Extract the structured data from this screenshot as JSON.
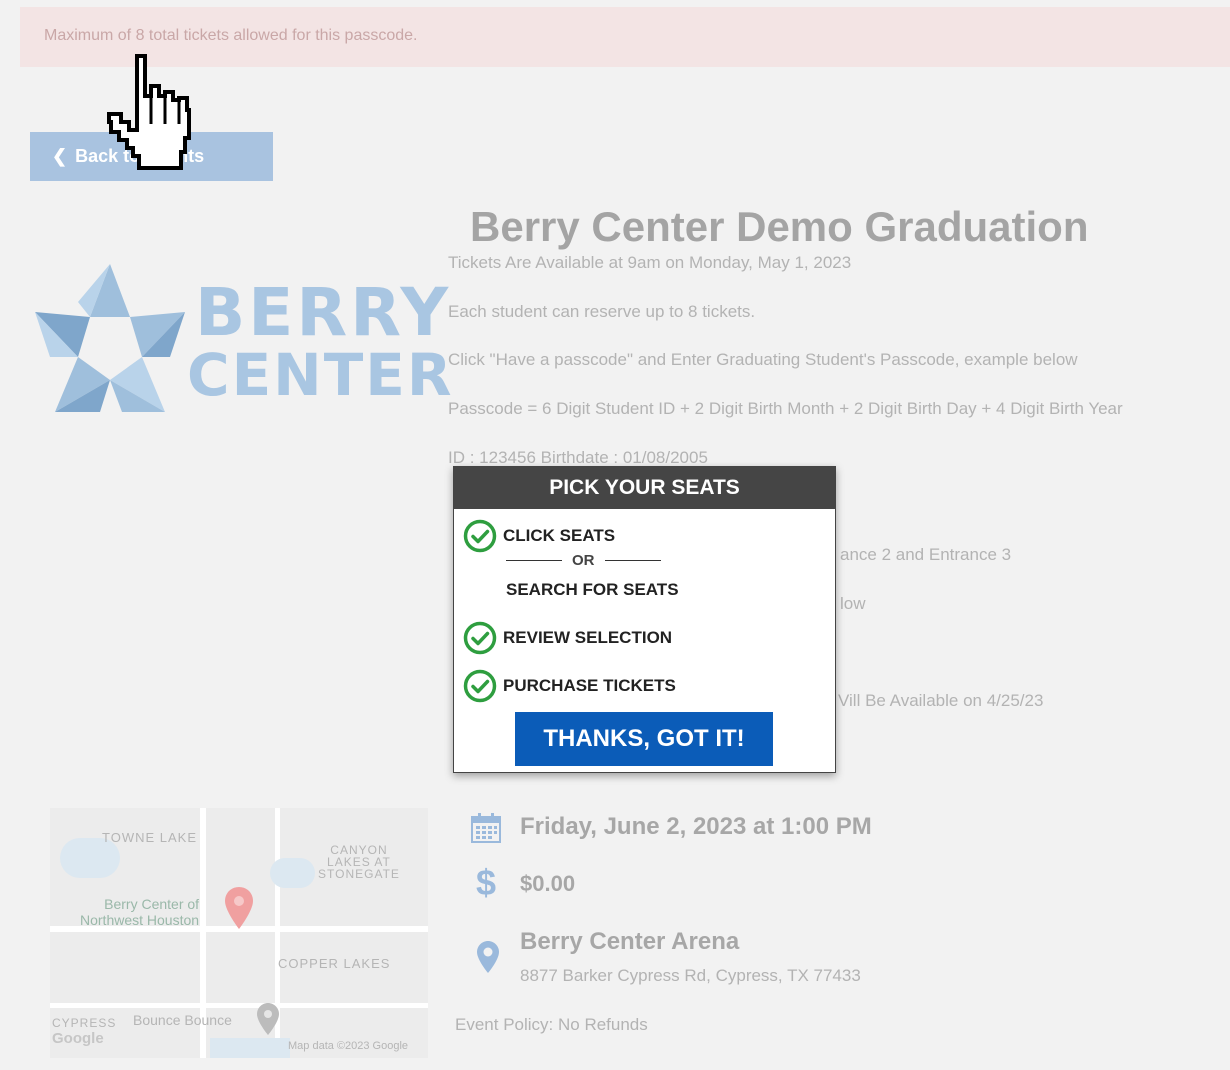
{
  "alert": {
    "text": "Maximum of 8 total tickets allowed for this passcode."
  },
  "back_button": {
    "label": "Back to Events"
  },
  "logo": {
    "line1": "BERRY",
    "line2": "CENTER"
  },
  "event": {
    "title": "Berry Center Demo Graduation",
    "description": [
      "Tickets Are Available at 9am on Monday, May 1, 2023",
      "Each student can reserve up to 8 tickets.",
      "Click \"Have a passcode\" and Enter Graduating Student's Passcode, example below",
      "Passcode = 6 Digit Student ID + 2 Digit Birth Month + 2 Digit Birth Day + 4 Digit Birth Year",
      "ID : 123456 Birthdate : 01/08/2005"
    ],
    "partial_visible": [
      "ance 2 and Entrance 3",
      "low",
      "Vill Be Available on 4/25/23"
    ],
    "date": "Friday, June 2, 2023 at 1:00 PM",
    "price": "$0.00",
    "venue_name": "Berry Center Arena",
    "venue_address": "8877 Barker Cypress Rd, Cypress, TX 77433",
    "policy": "Event Policy: No Refunds"
  },
  "map": {
    "labels": {
      "towne_lake": "TOWNE LAKE",
      "canyon1": "CANYON",
      "canyon2": "LAKES AT",
      "canyon3": "STONEGATE",
      "berry1": "Berry Center of",
      "berry2": "Northwest Houston",
      "copper": "COPPER LAKES",
      "cypress": "CYPRESS",
      "bounce": "Bounce Bounce",
      "google": "Google",
      "attribution": "Map data ©2023 Google"
    }
  },
  "modal": {
    "header": "PICK YOUR SEATS",
    "step_click": "CLICK SEATS",
    "or": "OR",
    "step_search": "SEARCH FOR SEATS",
    "step_review": "REVIEW SELECTION",
    "step_purchase": "PURCHASE TICKETS",
    "cta": "THANKS, GOT IT!"
  },
  "colors": {
    "accent_blue": "#0b5cb8",
    "check_green": "#2e9e3f",
    "alert_bg": "#f3e4e4"
  }
}
